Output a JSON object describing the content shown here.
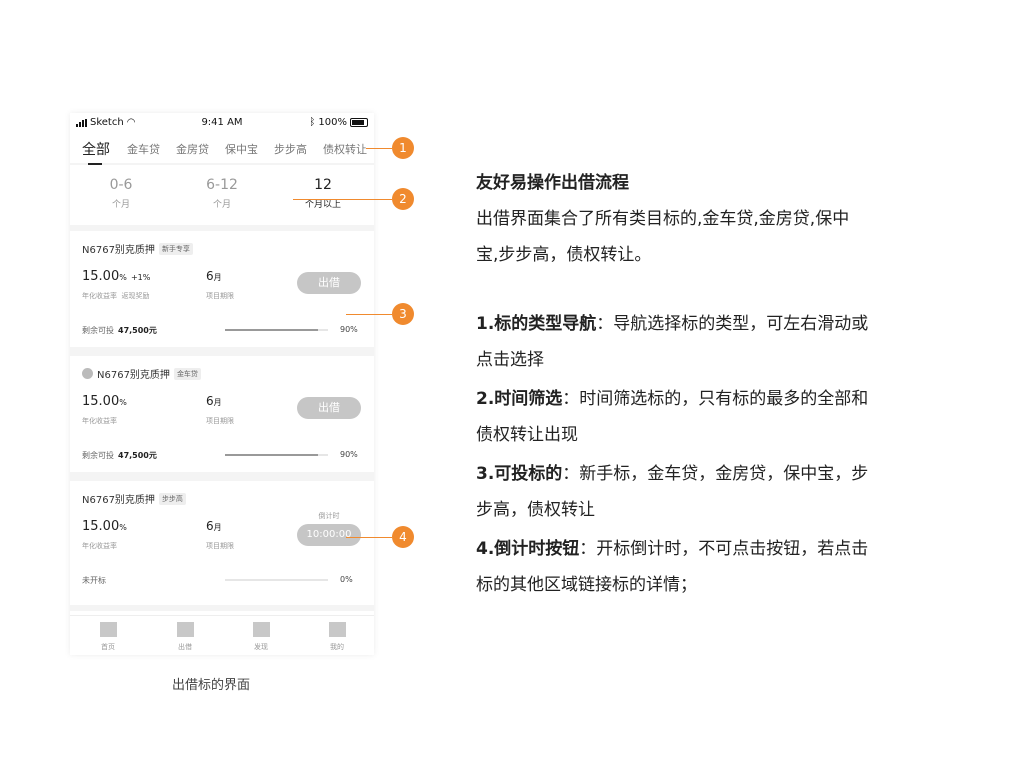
{
  "status": {
    "carrier": "Sketch",
    "time": "9:41 AM",
    "battery": "100%"
  },
  "tabs": [
    "全部",
    "金车贷",
    "金房贷",
    "保中宝",
    "步步高",
    "债权转让"
  ],
  "filters": [
    {
      "num": "0-6",
      "unit": "个月"
    },
    {
      "num": "6-12",
      "unit": "个月"
    },
    {
      "num": "12",
      "unit": "个月以上"
    }
  ],
  "cards": [
    {
      "title": "N6767别克质押",
      "tag": "新手专享",
      "rate": "15.00",
      "rate_unit": "%",
      "bonus": "+1%",
      "rate_label": "年化收益率",
      "bonus_label": "返现奖励",
      "term": "6",
      "term_unit": "月",
      "term_label": "项目期限",
      "button": "出借",
      "foot_label": "剩余可投",
      "foot_value": "47,500元",
      "progress": 0.9,
      "percent": "90%"
    },
    {
      "title": "N6767别克质押",
      "tag": "金车贷",
      "rate": "15.00",
      "rate_unit": "%",
      "rate_label": "年化收益率",
      "term": "6",
      "term_unit": "月",
      "term_label": "项目期限",
      "button": "出借",
      "foot_label": "剩余可投",
      "foot_value": "47,500元",
      "progress": 0.9,
      "percent": "90%"
    },
    {
      "title": "N6767别克质押",
      "tag": "步步高",
      "rate": "15.00",
      "rate_unit": "%",
      "rate_label": "年化收益率",
      "term": "6",
      "term_unit": "月",
      "term_label": "项目期限",
      "countdown_label": "倒计时",
      "button": "10:00:00",
      "foot_label": "未开标",
      "progress": 0,
      "percent": "0%"
    }
  ],
  "tabbar": [
    "首页",
    "出借",
    "发现",
    "我的"
  ],
  "caption": "出借标的界面",
  "callouts": [
    "1",
    "2",
    "3",
    "4"
  ],
  "description": {
    "heading": "友好易操作出借流程",
    "intro_1": "出借界面集合了所有类目标的,金车贷,金房贷,保中",
    "intro_2": "宝,步步高，债权转让。",
    "p1_head": "1.标的类型导航",
    "p1_1": "：导航选择标的类型，可左右滑动或",
    "p1_2": "点击选择",
    "p2_head": "2.时间筛选",
    "p2_1": "：时间筛选标的，只有标的最多的全部和",
    "p2_2": "债权转让出现",
    "p3_head": "3.可投标的",
    "p3_1": "：新手标，金车贷，金房贷，保中宝，步",
    "p3_2": "步高，债权转让",
    "p4_head": "4.倒计时按钮",
    "p4_1": "：开标倒计时，不可点击按钮，若点击",
    "p4_2": "标的其他区域链接标的详情；"
  },
  "colors": {
    "accent": "#f08a2e",
    "button": "#c6c6c6"
  }
}
